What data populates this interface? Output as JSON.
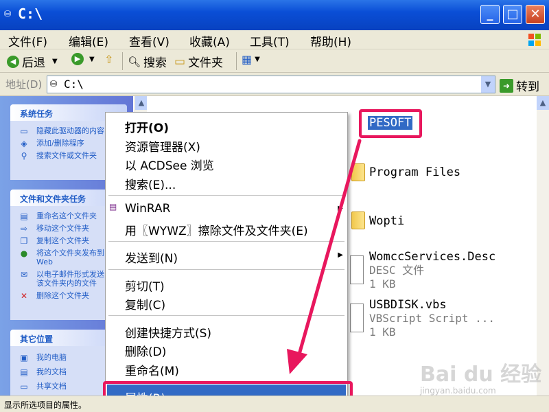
{
  "window": {
    "title": "C:\\"
  },
  "menu": [
    "文件(F)",
    "编辑(E)",
    "查看(V)",
    "收藏(A)",
    "工具(T)",
    "帮助(H)"
  ],
  "toolbar": {
    "back": "后退",
    "search": "搜索",
    "folders": "文件夹"
  },
  "address": {
    "label": "地址(D)",
    "value": "C:\\",
    "go": "转到"
  },
  "tasks": {
    "system": {
      "title": "系统任务",
      "items": [
        "隐藏此驱动器的内容",
        "添加/删除程序",
        "搜索文件或文件夹"
      ]
    },
    "file": {
      "title": "文件和文件夹任务",
      "items": [
        "重命名这个文件夹",
        "移动这个文件夹",
        "复制这个文件夹",
        "将这个文件夹发布到\nWeb",
        "以电子邮件形式发送\n该文件夹内的文件",
        "删除这个文件夹"
      ]
    },
    "other": {
      "title": "其它位置",
      "items": [
        "我的电脑",
        "我的文档",
        "共享文档"
      ]
    }
  },
  "files": [
    {
      "name": "PESOFT"
    },
    {
      "name": "Program Files"
    },
    {
      "name": "Wopti"
    },
    {
      "name": "WomccServices.Desc",
      "type": "DESC 文件",
      "size": "1 KB"
    },
    {
      "name": "USBDISK.vbs",
      "type": "VBScript Script ...",
      "size": "1 KB"
    }
  ],
  "context_menu": [
    "打开(O)",
    "资源管理器(X)",
    "以 ACDSee 浏览",
    "搜索(E)...",
    "WinRAR",
    "用〖WYWZ〗擦除文件及文件夹(E)",
    "发送到(N)",
    "剪切(T)",
    "复制(C)",
    "创建快捷方式(S)",
    "删除(D)",
    "重命名(M)",
    "属性(R)"
  ],
  "status": "显示所选项目的属性。",
  "watermark": {
    "logo": "Bai du 经验",
    "url": "jingyan.baidu.com"
  },
  "colors": {
    "highlight": "#e8175d",
    "selection": "#316ac5",
    "titlebar": "#0a4ed6"
  }
}
